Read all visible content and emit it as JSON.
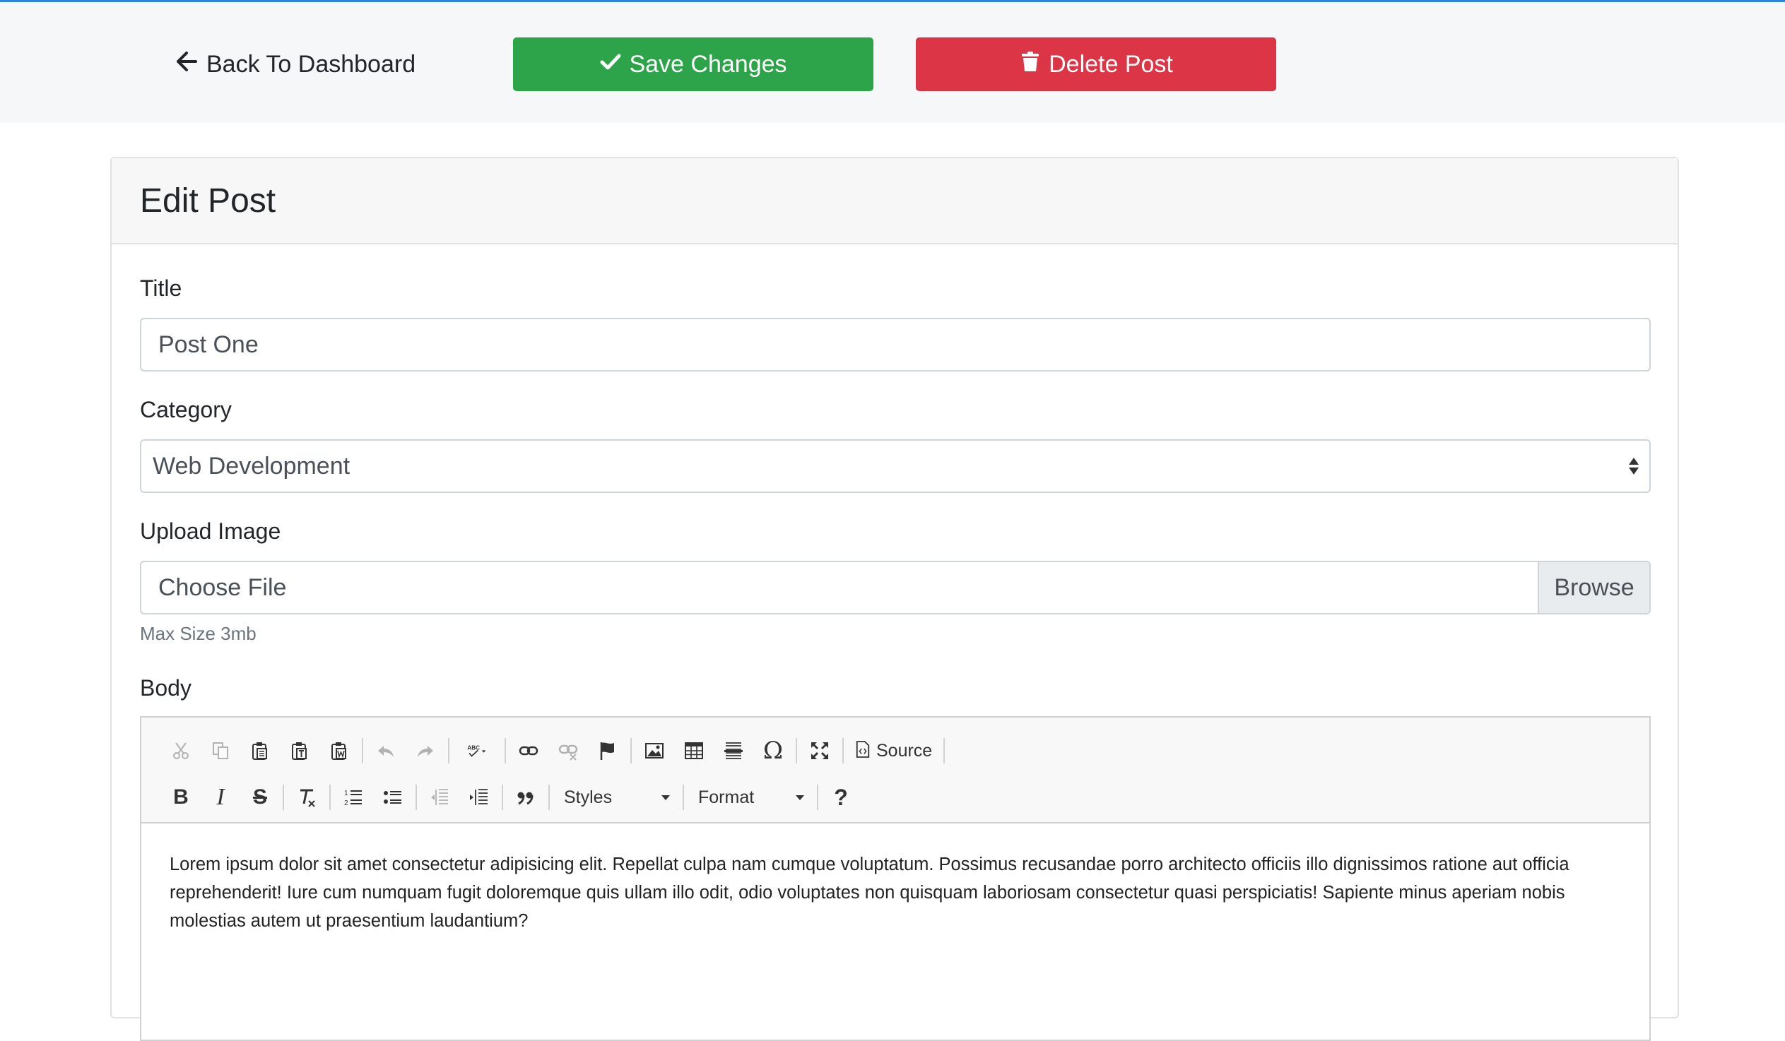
{
  "topbar": {
    "back_label": "Back To Dashboard",
    "save_label": "Save Changes",
    "delete_label": "Delete Post"
  },
  "card": {
    "title": "Edit Post"
  },
  "form": {
    "title_label": "Title",
    "title_value": "Post One",
    "category_label": "Category",
    "category_value": "Web Development",
    "image_label": "Upload Image",
    "file_placeholder": "Choose File",
    "browse_label": "Browse",
    "image_help": "Max Size 3mb",
    "body_label": "Body"
  },
  "editor": {
    "source_label": "Source",
    "styles_label": "Styles",
    "format_label": "Format",
    "help_glyph": "?",
    "body_text": "Lorem ipsum dolor sit amet consectetur adipisicing elit. Repellat culpa nam cumque voluptatum. Possimus recusandae porro architecto officiis illo dignissimos ratione aut officia reprehenderit! Iure cum numquam fugit doloremque quis ullam illo odit, odio voluptates non quisquam laboriosam consectetur quasi perspiciatis! Sapiente minus aperiam nobis molestias autem ut praesentium laudantium?"
  },
  "colors": {
    "save": "#2ea44a",
    "delete": "#dc3545",
    "top_border": "#2f86e0"
  },
  "icons": {
    "back": "arrow-left-icon",
    "save": "check-icon",
    "delete": "trash-icon"
  }
}
